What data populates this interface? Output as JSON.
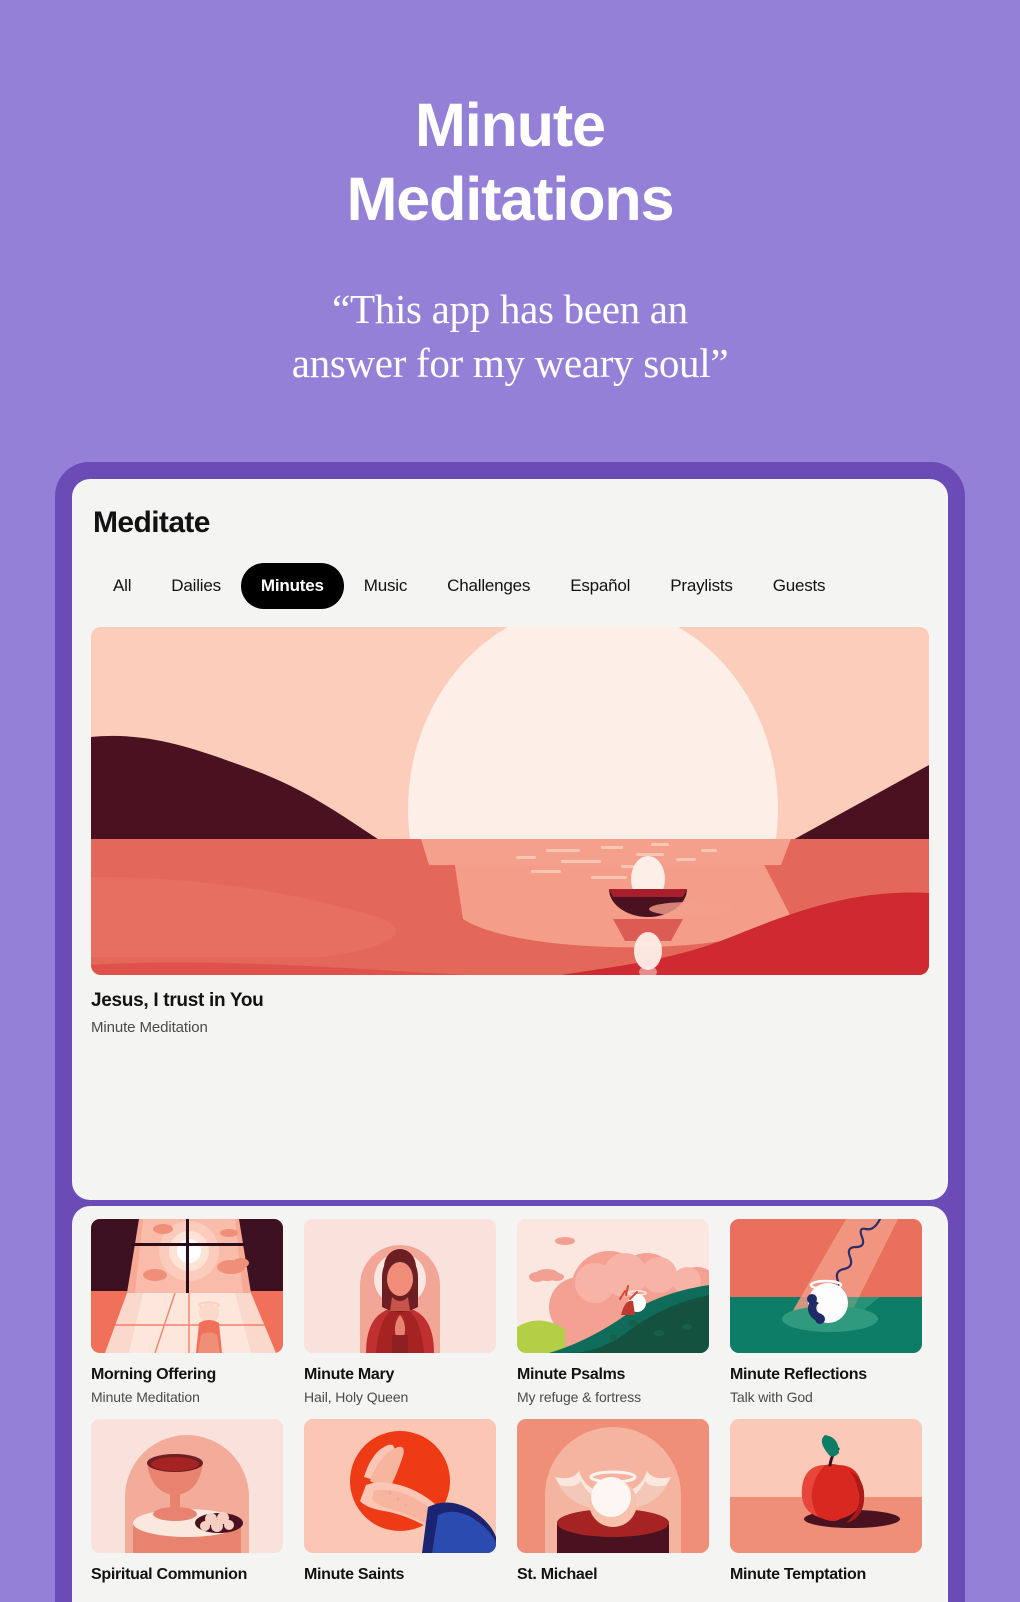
{
  "promo": {
    "title_line1": "Minute",
    "title_line2": "Meditations",
    "quote_line1": "“This app has been an",
    "quote_line2": "answer for my weary soul”",
    "background_color": "#9580d8",
    "text_color": "#ffffff"
  },
  "device": {
    "bezel_color": "#6b4bb5",
    "screen_color": "#f4f4f3"
  },
  "app": {
    "title": "Meditate",
    "tabs": [
      {
        "label": "All",
        "active": false
      },
      {
        "label": "Dailies",
        "active": false
      },
      {
        "label": "Minutes",
        "active": true
      },
      {
        "label": "Music",
        "active": false
      },
      {
        "label": "Challenges",
        "active": false
      },
      {
        "label": "Español",
        "active": false
      },
      {
        "label": "Praylists",
        "active": false
      },
      {
        "label": "Guests",
        "active": false
      }
    ],
    "active_tab_bg": "#000000",
    "active_tab_text": "#ffffff"
  },
  "hero": {
    "title": "Jesus, I trust in You",
    "subtitle": "Minute Meditation",
    "artwork_name": "sunset-lake-boat",
    "colors": {
      "sky": "#fbcdba",
      "sun": "#fdeee8",
      "hills": "#4a1220",
      "water": "#e4685a",
      "water_light": "#f08a76",
      "water_dark": "#cf2a31"
    }
  },
  "cards": [
    {
      "title": "Morning Offering",
      "subtitle": "Minute Meditation",
      "artwork_name": "window-sunrise-figure"
    },
    {
      "title": "Minute Mary",
      "subtitle": "Hail, Holy Queen",
      "artwork_name": "mary-arch-praying"
    },
    {
      "title": "Minute Psalms",
      "subtitle": "My refuge & fortress",
      "artwork_name": "clouds-green-hill"
    },
    {
      "title": "Minute Reflections",
      "subtitle": "Talk with God",
      "artwork_name": "halo-head-phone-cord"
    },
    {
      "title": "Spiritual Communion",
      "subtitle": "",
      "artwork_name": "chalice-and-hosts"
    },
    {
      "title": "Minute Saints",
      "subtitle": "",
      "artwork_name": "praying-hands-red-circle"
    },
    {
      "title": "St. Michael",
      "subtitle": "",
      "artwork_name": "winged-angel-halo"
    },
    {
      "title": "Minute Temptation",
      "subtitle": "",
      "artwork_name": "red-apple-shadow"
    }
  ]
}
